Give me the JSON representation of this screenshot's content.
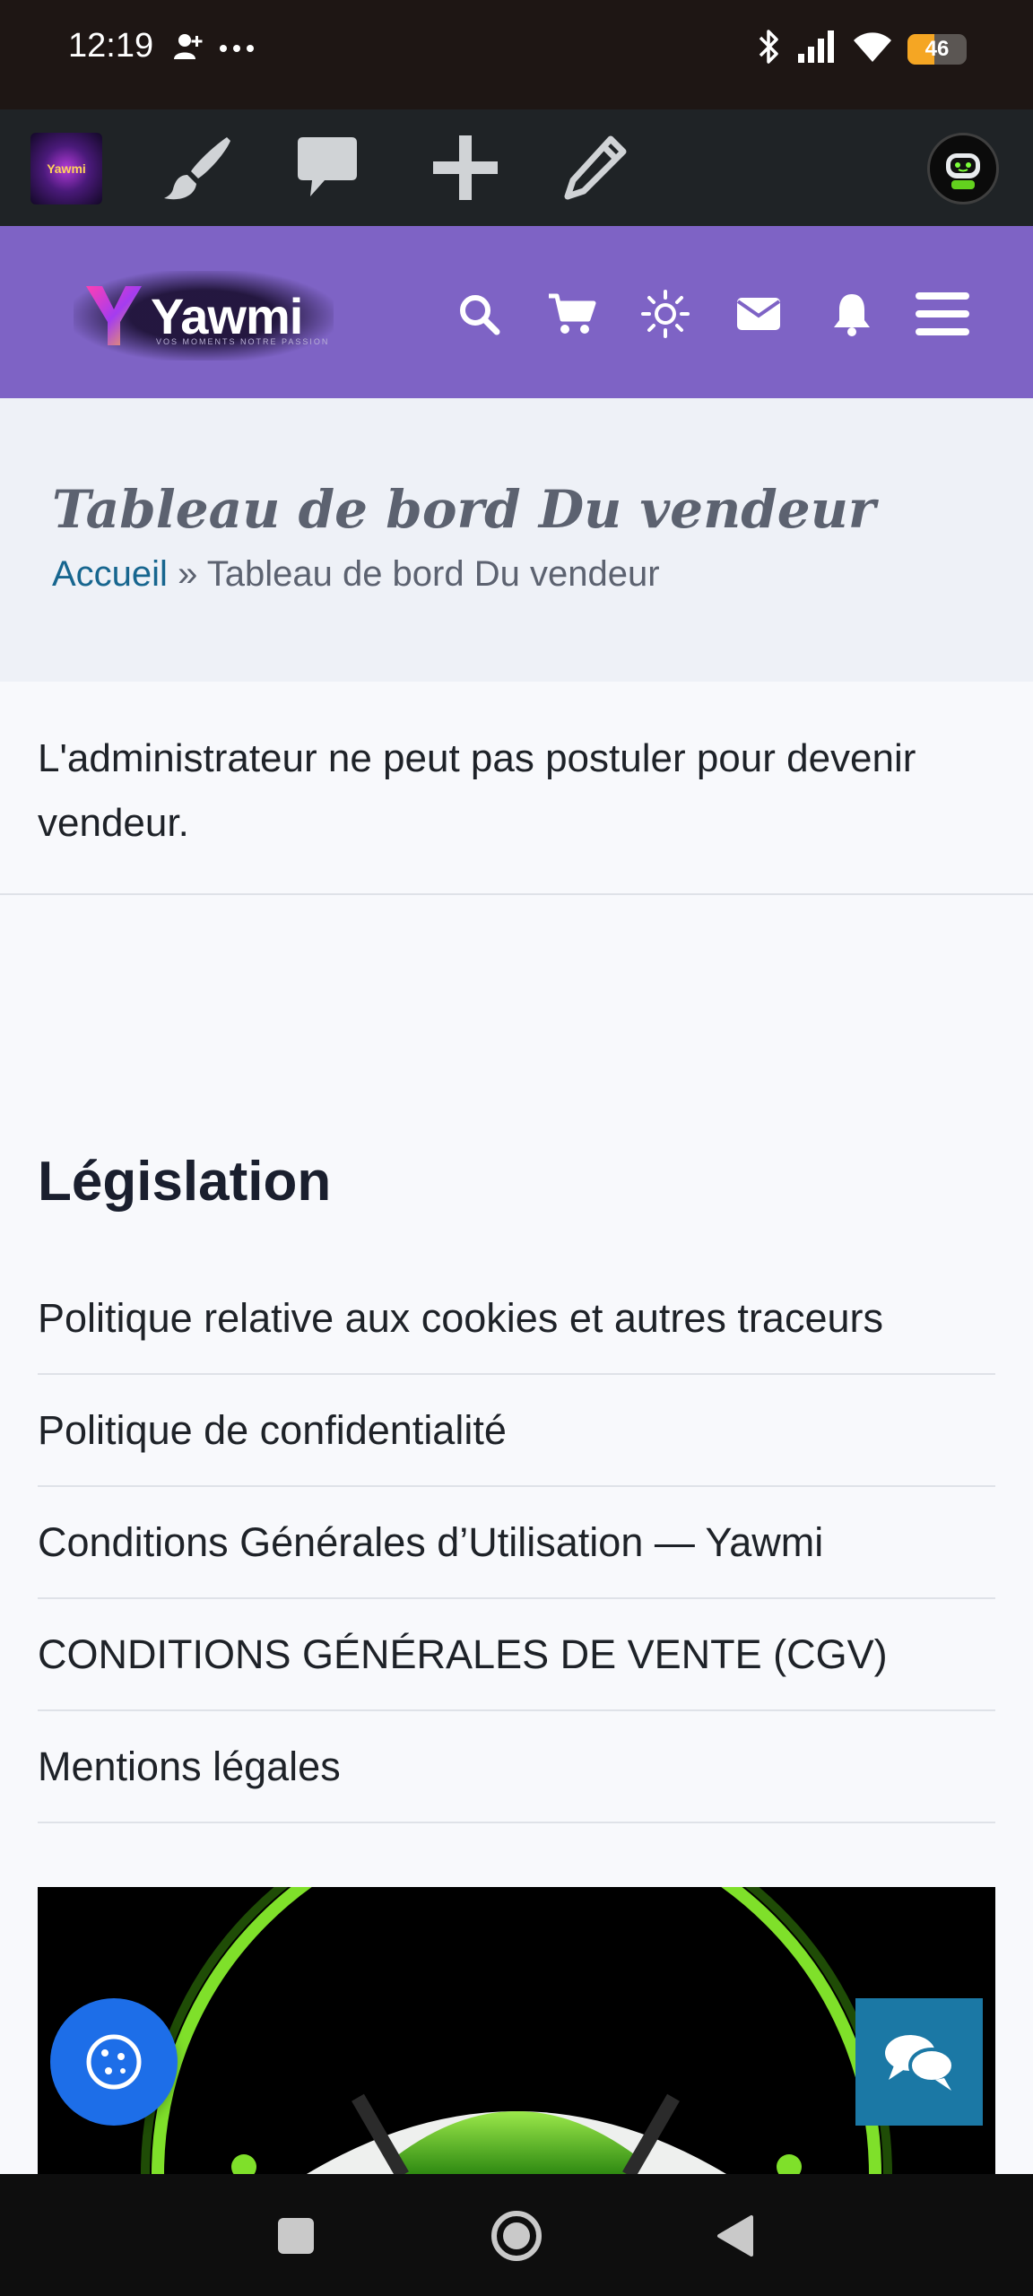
{
  "status_bar": {
    "time": "12:19",
    "battery_level": "46",
    "battery_percent": 46,
    "icons": [
      "person-add-icon",
      "more-dots-icon",
      "bluetooth-icon",
      "signal-icon",
      "wifi-icon",
      "battery-icon"
    ]
  },
  "admin_bar": {
    "logo_text": "Yawmi",
    "icons": [
      "brush-icon",
      "comment-icon",
      "plus-icon",
      "pencil-icon",
      "robot-avatar-icon"
    ]
  },
  "header": {
    "logo_text": "Yawmi",
    "logo_tagline": "VOS MOMENTS NOTRE PASSION",
    "icons": [
      "search-icon",
      "cart-icon",
      "sun-icon",
      "mail-icon",
      "bell-icon",
      "menu-icon"
    ]
  },
  "page": {
    "title": "Tableau de bord Du vendeur",
    "breadcrumb": {
      "home": "Accueil",
      "separator": "»",
      "current": "Tableau de bord Du vendeur"
    }
  },
  "notice": {
    "text": "L'administrateur ne peut pas postuler pour devenir vendeur."
  },
  "legislation": {
    "heading": "Législation",
    "links": [
      "Politique relative aux cookies et autres traceurs",
      "Politique de confidentialité",
      "Conditions Générales d’Utilisation — Yawmi",
      "CONDITIONS GÉNÉRALES DE VENTE (CGV)",
      "Mentions légales"
    ]
  },
  "colors": {
    "status_bar": "#1e1614",
    "admin_bar": "#1f2326",
    "header": "#7e63c5",
    "link": "#17668f",
    "cookie_button": "#1d6ee8",
    "chat_button": "#1b78a5",
    "battery": "#f5a623"
  }
}
